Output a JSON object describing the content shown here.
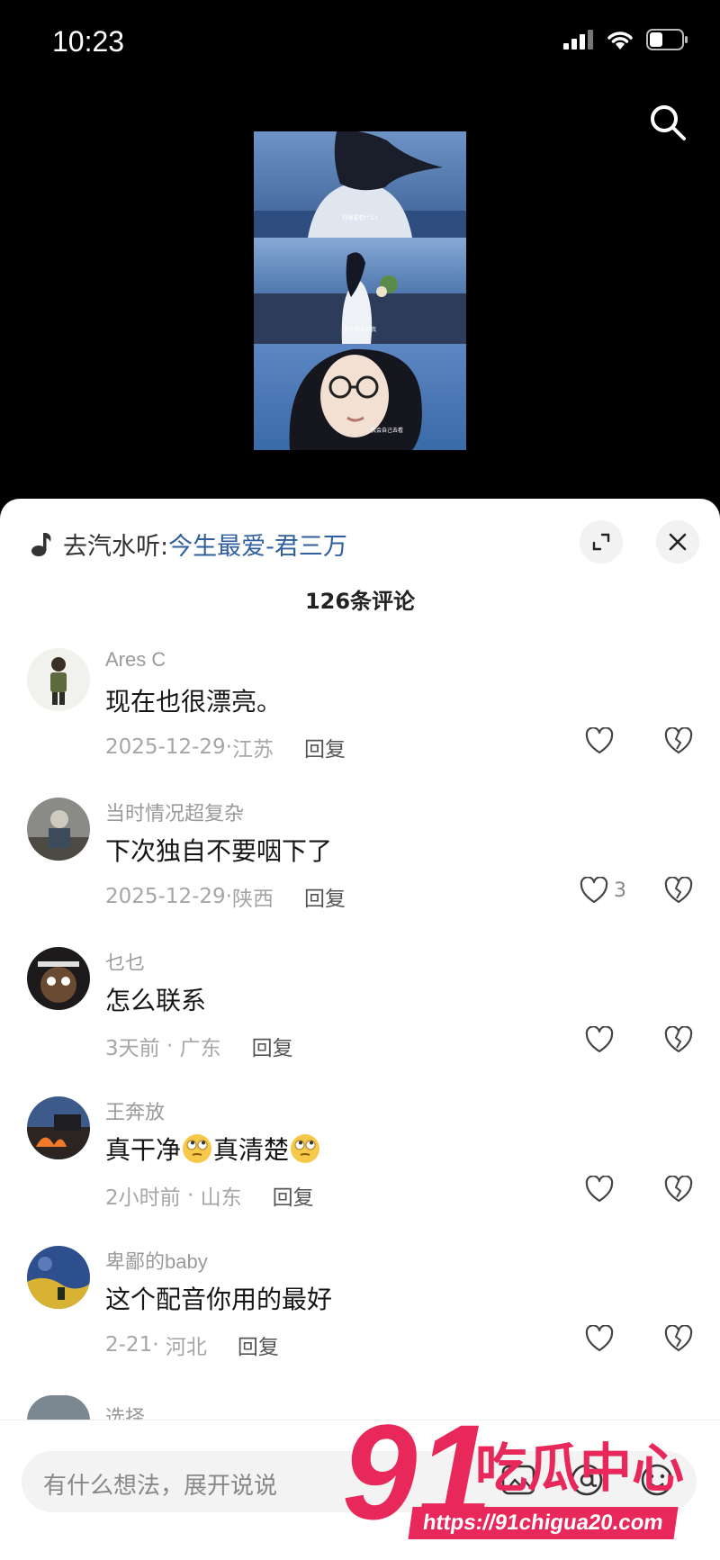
{
  "status": {
    "time": "10:23"
  },
  "sheet": {
    "music_prefix": "去汽水听:",
    "music_link": "今生最爱-君三万",
    "comment_count": "126条评论"
  },
  "comments": [
    {
      "user": "Ares C",
      "text": "现在也很漂亮。",
      "date": "2025-12-29",
      "region": "江苏",
      "reply": "回复",
      "likes": ""
    },
    {
      "user": "当时情况超复杂",
      "text": "下次独自不要咽下了",
      "date": "2025-12-29",
      "region": "陕西",
      "reply": "回复",
      "likes": "3"
    },
    {
      "user": "乜乜",
      "text": "怎么联系",
      "date": "3天前",
      "region": "广东",
      "reply": "回复",
      "likes": ""
    },
    {
      "user": "王奔放",
      "text_a": "真干净",
      "text_b": "真清楚",
      "date": "2小时前",
      "region": "山东",
      "reply": "回复",
      "likes": ""
    },
    {
      "user": "卑鄙的baby",
      "text": "这个配音你用的最好",
      "date": "2-21",
      "region": "河北",
      "reply": "回复",
      "likes": ""
    }
  ],
  "partial_user": "选择",
  "input": {
    "placeholder": "有什么想法，展开说说"
  },
  "watermark": {
    "number": "91",
    "text": "吃瓜中心",
    "url": "https://91chigua20.com"
  },
  "video_subtitles": [
    "你想要看什么?",
    "你不用告诉我",
    "我会自己去看"
  ],
  "colors": {
    "link": "#2f5f9c",
    "watermark": "#e8285a"
  }
}
